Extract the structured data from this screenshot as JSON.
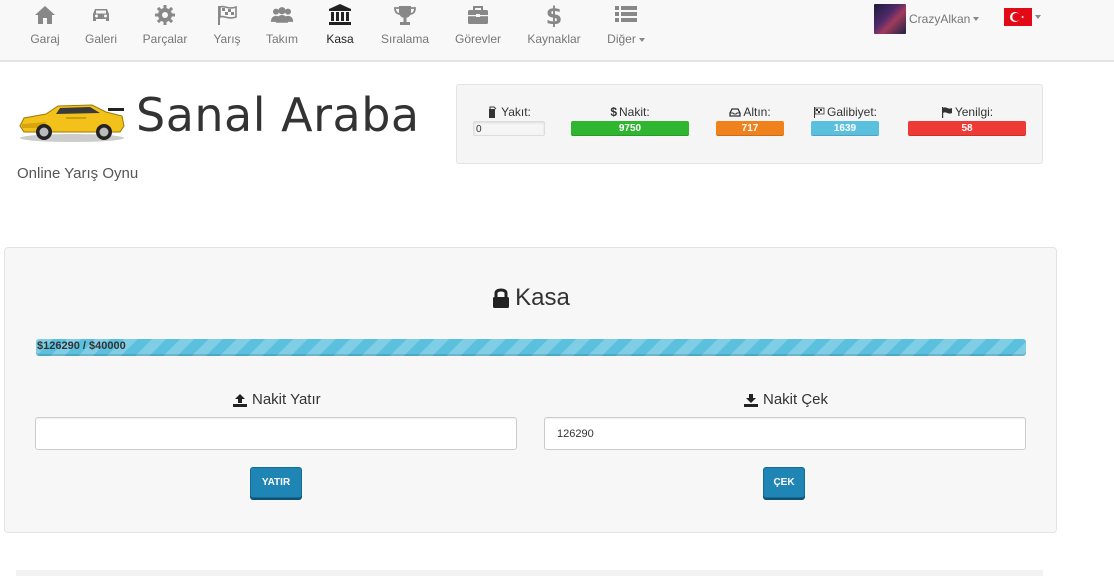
{
  "nav": {
    "items": [
      {
        "label": "Garaj",
        "icon": "home-icon"
      },
      {
        "label": "Galeri",
        "icon": "car-icon"
      },
      {
        "label": "Parçalar",
        "icon": "gear-icon"
      },
      {
        "label": "Yarış",
        "icon": "checkered-flag-icon"
      },
      {
        "label": "Takım",
        "icon": "users-icon"
      },
      {
        "label": "Kasa",
        "icon": "bank-icon"
      },
      {
        "label": "Sıralama",
        "icon": "trophy-icon"
      },
      {
        "label": "Görevler",
        "icon": "briefcase-icon"
      },
      {
        "label": "Kaynaklar",
        "icon": "dollar-icon"
      },
      {
        "label": "Diğer",
        "icon": "list-icon"
      }
    ],
    "user": "CrazyAlkan"
  },
  "header": {
    "title": "Sanal Araba",
    "subtitle": "Online Yarış Oynu"
  },
  "stats": {
    "fuel": {
      "label": "Yakıt:",
      "value": "0"
    },
    "cash": {
      "label": "Nakit:",
      "value": "9750",
      "color": "#2fb52f"
    },
    "gold": {
      "label": "Altın:",
      "value": "717",
      "color": "#f0821e"
    },
    "wins": {
      "label": "Galibiyet:",
      "value": "1639",
      "color": "#5bc0de"
    },
    "losses": {
      "label": "Yenilgi:",
      "value": "58",
      "color": "#ee3a35"
    }
  },
  "kasa": {
    "title": "Kasa",
    "progress_text": "$126290 / $40000",
    "deposit": {
      "heading": "Nakit Yatır",
      "value": "",
      "button": "YATIR"
    },
    "withdraw": {
      "heading": "Nakit Çek",
      "value": "126290",
      "button": "ÇEK"
    }
  }
}
